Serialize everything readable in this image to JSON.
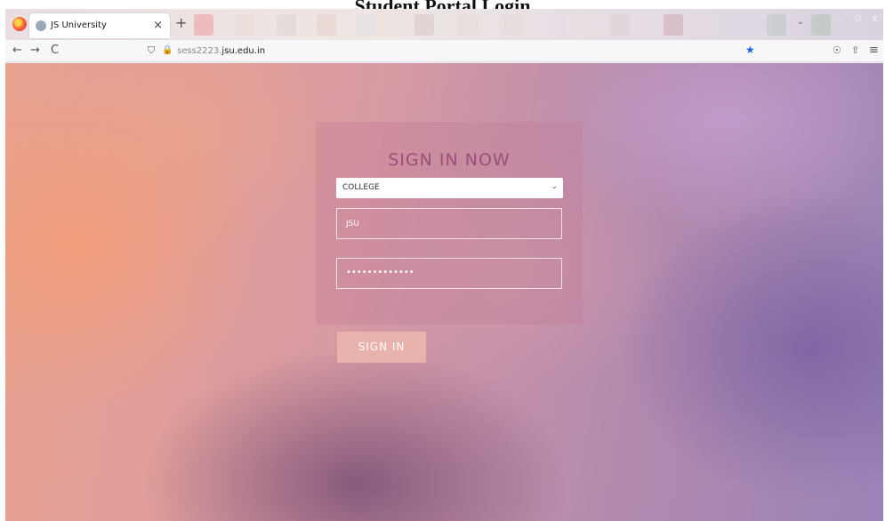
{
  "caption": "Student Portal Login",
  "browser": {
    "tab_title": "JS University",
    "tab_close": "×",
    "new_tab": "+",
    "tab_list": "⌄",
    "win_min": "–",
    "win_max": "⊙",
    "win_close": "x",
    "nav": {
      "back": "←",
      "forward": "→",
      "reload": "C",
      "shield": "⛉",
      "lock": "🔒",
      "star": "★",
      "pocket": "☉",
      "share": "⇧",
      "menu": "≡"
    },
    "url_prefix": "sess2223.",
    "url_domain": "jsu.edu.in"
  },
  "login": {
    "heading": "SIGN IN NOW",
    "college_selected": "COLLEGE",
    "chevron": "⌄",
    "username_value": "JSU",
    "password_mask": "•••••••••••••",
    "signin_label": "SIGN IN"
  },
  "colors": {
    "heading": "#9b4f78",
    "button": "#e9b2ad",
    "bookmark_star": "#1a66d6"
  }
}
